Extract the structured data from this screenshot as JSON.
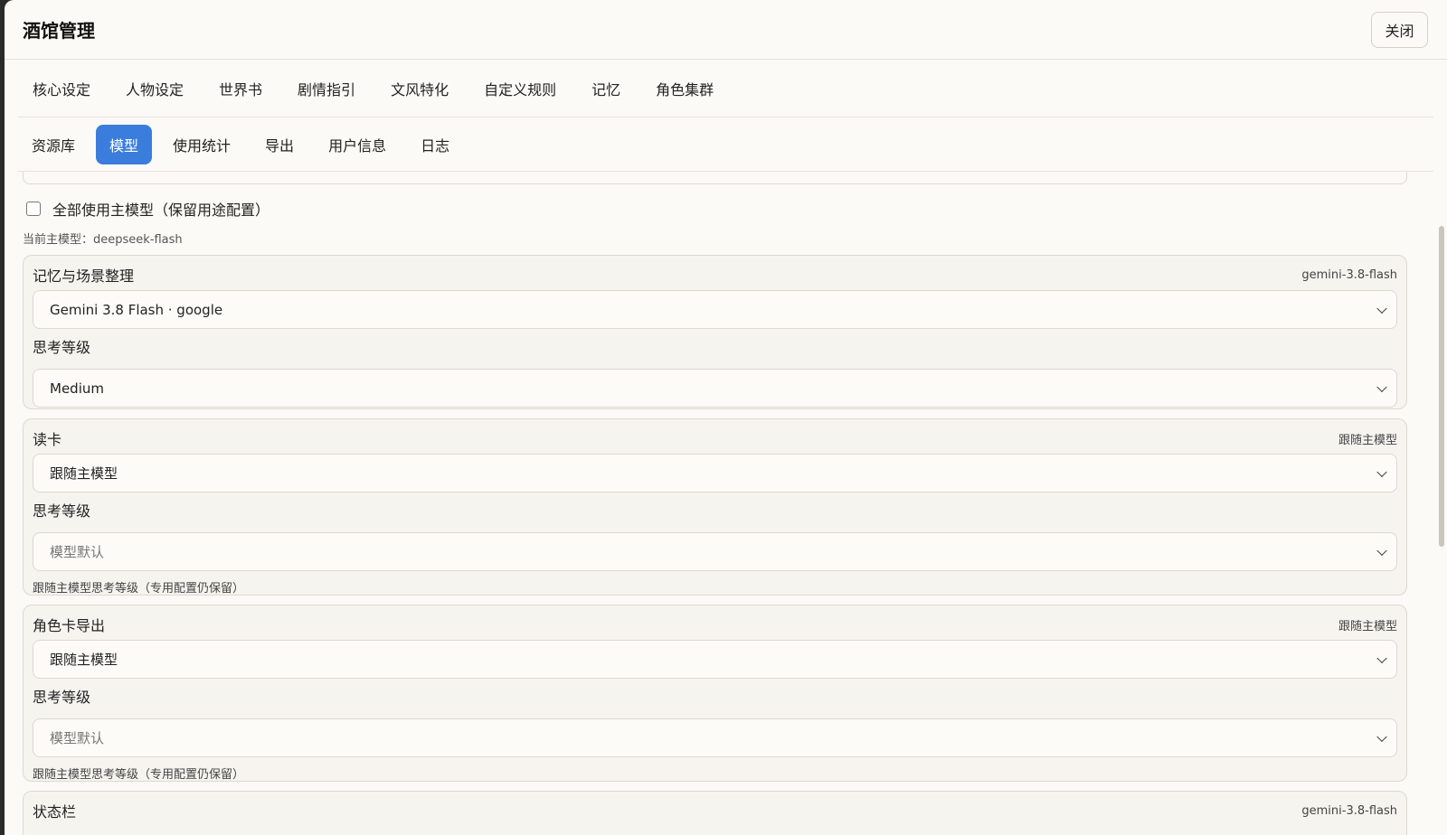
{
  "header": {
    "title": "酒馆管理",
    "close_label": "关闭"
  },
  "tabs_primary": [
    {
      "label": "核心设定"
    },
    {
      "label": "人物设定"
    },
    {
      "label": "世界书"
    },
    {
      "label": "剧情指引"
    },
    {
      "label": "文风特化"
    },
    {
      "label": "自定义规则"
    },
    {
      "label": "记忆"
    },
    {
      "label": "角色集群"
    }
  ],
  "tabs_secondary": [
    {
      "label": "资源库",
      "active": false
    },
    {
      "label": "模型",
      "active": true
    },
    {
      "label": "使用统计",
      "active": false
    },
    {
      "label": "导出",
      "active": false
    },
    {
      "label": "用户信息",
      "active": false
    },
    {
      "label": "日志",
      "active": false
    }
  ],
  "content": {
    "use_main_checkbox": {
      "label": "全部使用主模型（保留用途配置）",
      "checked": false
    },
    "main_model_line": "当前主模型：deepseek-flash",
    "cards": [
      {
        "label": "记忆与场景整理",
        "badge": "gemini-3.8-flash",
        "model_value": "Gemini 3.8 Flash · google",
        "think_label": "思考等级",
        "think_value": "Medium",
        "hint": ""
      },
      {
        "label": "读卡",
        "badge": "跟随主模型",
        "model_value": "跟随主模型",
        "think_label": "思考等级",
        "think_value": "模型默认",
        "hint": "跟随主模型思考等级（专用配置仍保留）"
      },
      {
        "label": "角色卡导出",
        "badge": "跟随主模型",
        "model_value": "跟随主模型",
        "think_label": "思考等级",
        "think_value": "模型默认",
        "hint": "跟随主模型思考等级（专用配置仍保留）"
      },
      {
        "label": "状态栏",
        "badge": "gemini-3.8-flash"
      }
    ]
  },
  "icons": {
    "select_arrow": "chevron-down-icon",
    "checkbox": "checkbox-icon"
  }
}
